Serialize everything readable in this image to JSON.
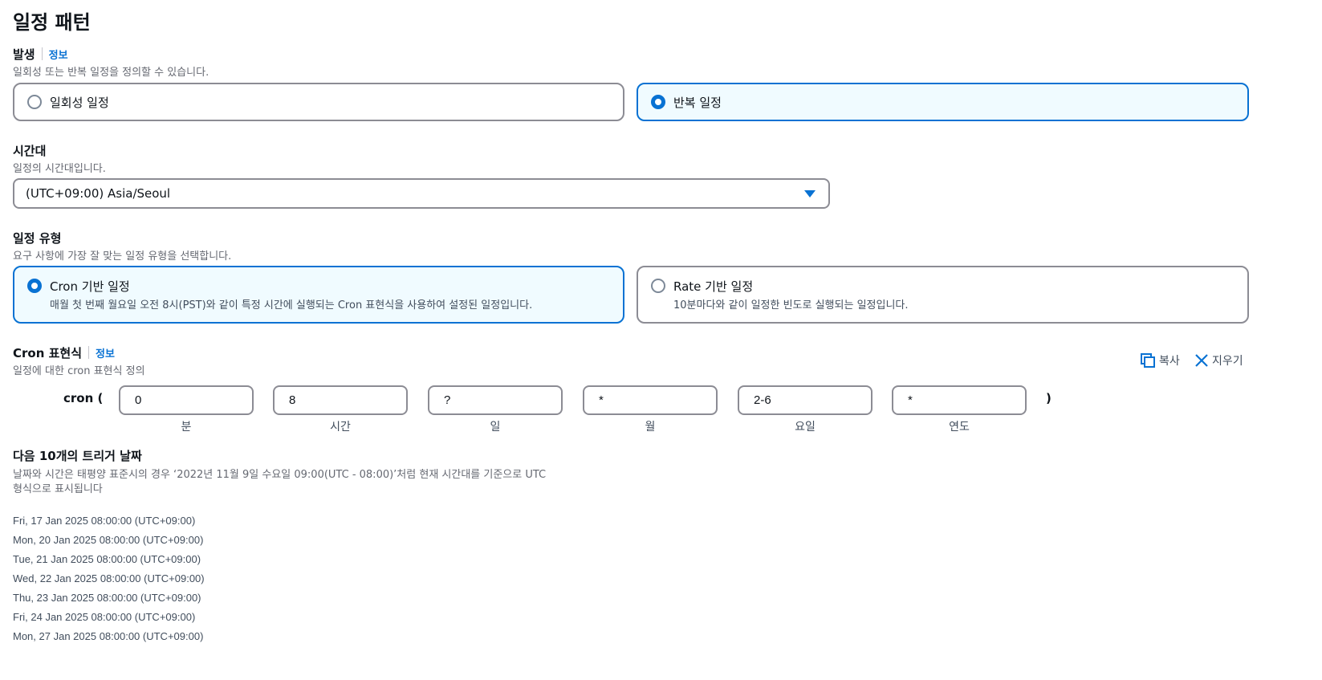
{
  "page_title": "일정 패턴",
  "occurrence": {
    "label": "발생",
    "info": "정보",
    "description": "일회성 또는 반복 일정을 정의할 수 있습니다.",
    "options": [
      {
        "label": "일회성 일정",
        "selected": false
      },
      {
        "label": "반복 일정",
        "selected": true
      }
    ]
  },
  "timezone": {
    "label": "시간대",
    "description": "일정의 시간대입니다.",
    "value": "(UTC+09:00) Asia/Seoul"
  },
  "schedule_type": {
    "label": "일정 유형",
    "description": "요구 사항에 가장 잘 맞는 일정 유형을 선택합니다.",
    "options": [
      {
        "title": "Cron 기반 일정",
        "description": "매월 첫 번째 월요일 오전 8시(PST)와 같이 특정 시간에 실행되는 Cron 표현식을 사용하여 설정된 일정입니다.",
        "selected": true
      },
      {
        "title": "Rate 기반 일정",
        "description": "10분마다와 같이 일정한 빈도로 실행되는 일정입니다.",
        "selected": false
      }
    ]
  },
  "cron": {
    "label": "Cron 표현식",
    "info": "정보",
    "description": "일정에 대한 cron 표현식 정의",
    "copy_label": "복사",
    "clear_label": "지우기",
    "prefix": "cron (",
    "suffix": ")",
    "fields": [
      {
        "value": "0",
        "caption": "분"
      },
      {
        "value": "8",
        "caption": "시간"
      },
      {
        "value": "?",
        "caption": "일"
      },
      {
        "value": "*",
        "caption": "월"
      },
      {
        "value": "2-6",
        "caption": "요일"
      },
      {
        "value": "*",
        "caption": "연도"
      }
    ]
  },
  "triggers": {
    "label": "다음 10개의 트리거 날짜",
    "description_line1": "날짜와 시간은 태평양 표준시의 경우 ‘2022년 11월 9일 수요일 09:00(UTC - 08:00)’처럼 현재 시간대를 기준으로 UTC",
    "description_line2": "형식으로 표시됩니다",
    "dates": [
      "Fri, 17 Jan 2025 08:00:00 (UTC+09:00)",
      "Mon, 20 Jan 2025 08:00:00 (UTC+09:00)",
      "Tue, 21 Jan 2025 08:00:00 (UTC+09:00)",
      "Wed, 22 Jan 2025 08:00:00 (UTC+09:00)",
      "Thu, 23 Jan 2025 08:00:00 (UTC+09:00)",
      "Fri, 24 Jan 2025 08:00:00 (UTC+09:00)",
      "Mon, 27 Jan 2025 08:00:00 (UTC+09:00)"
    ]
  },
  "colors": {
    "accent": "#0972d3",
    "selected_bg": "#f0fbff",
    "border": "#8c8c94"
  }
}
